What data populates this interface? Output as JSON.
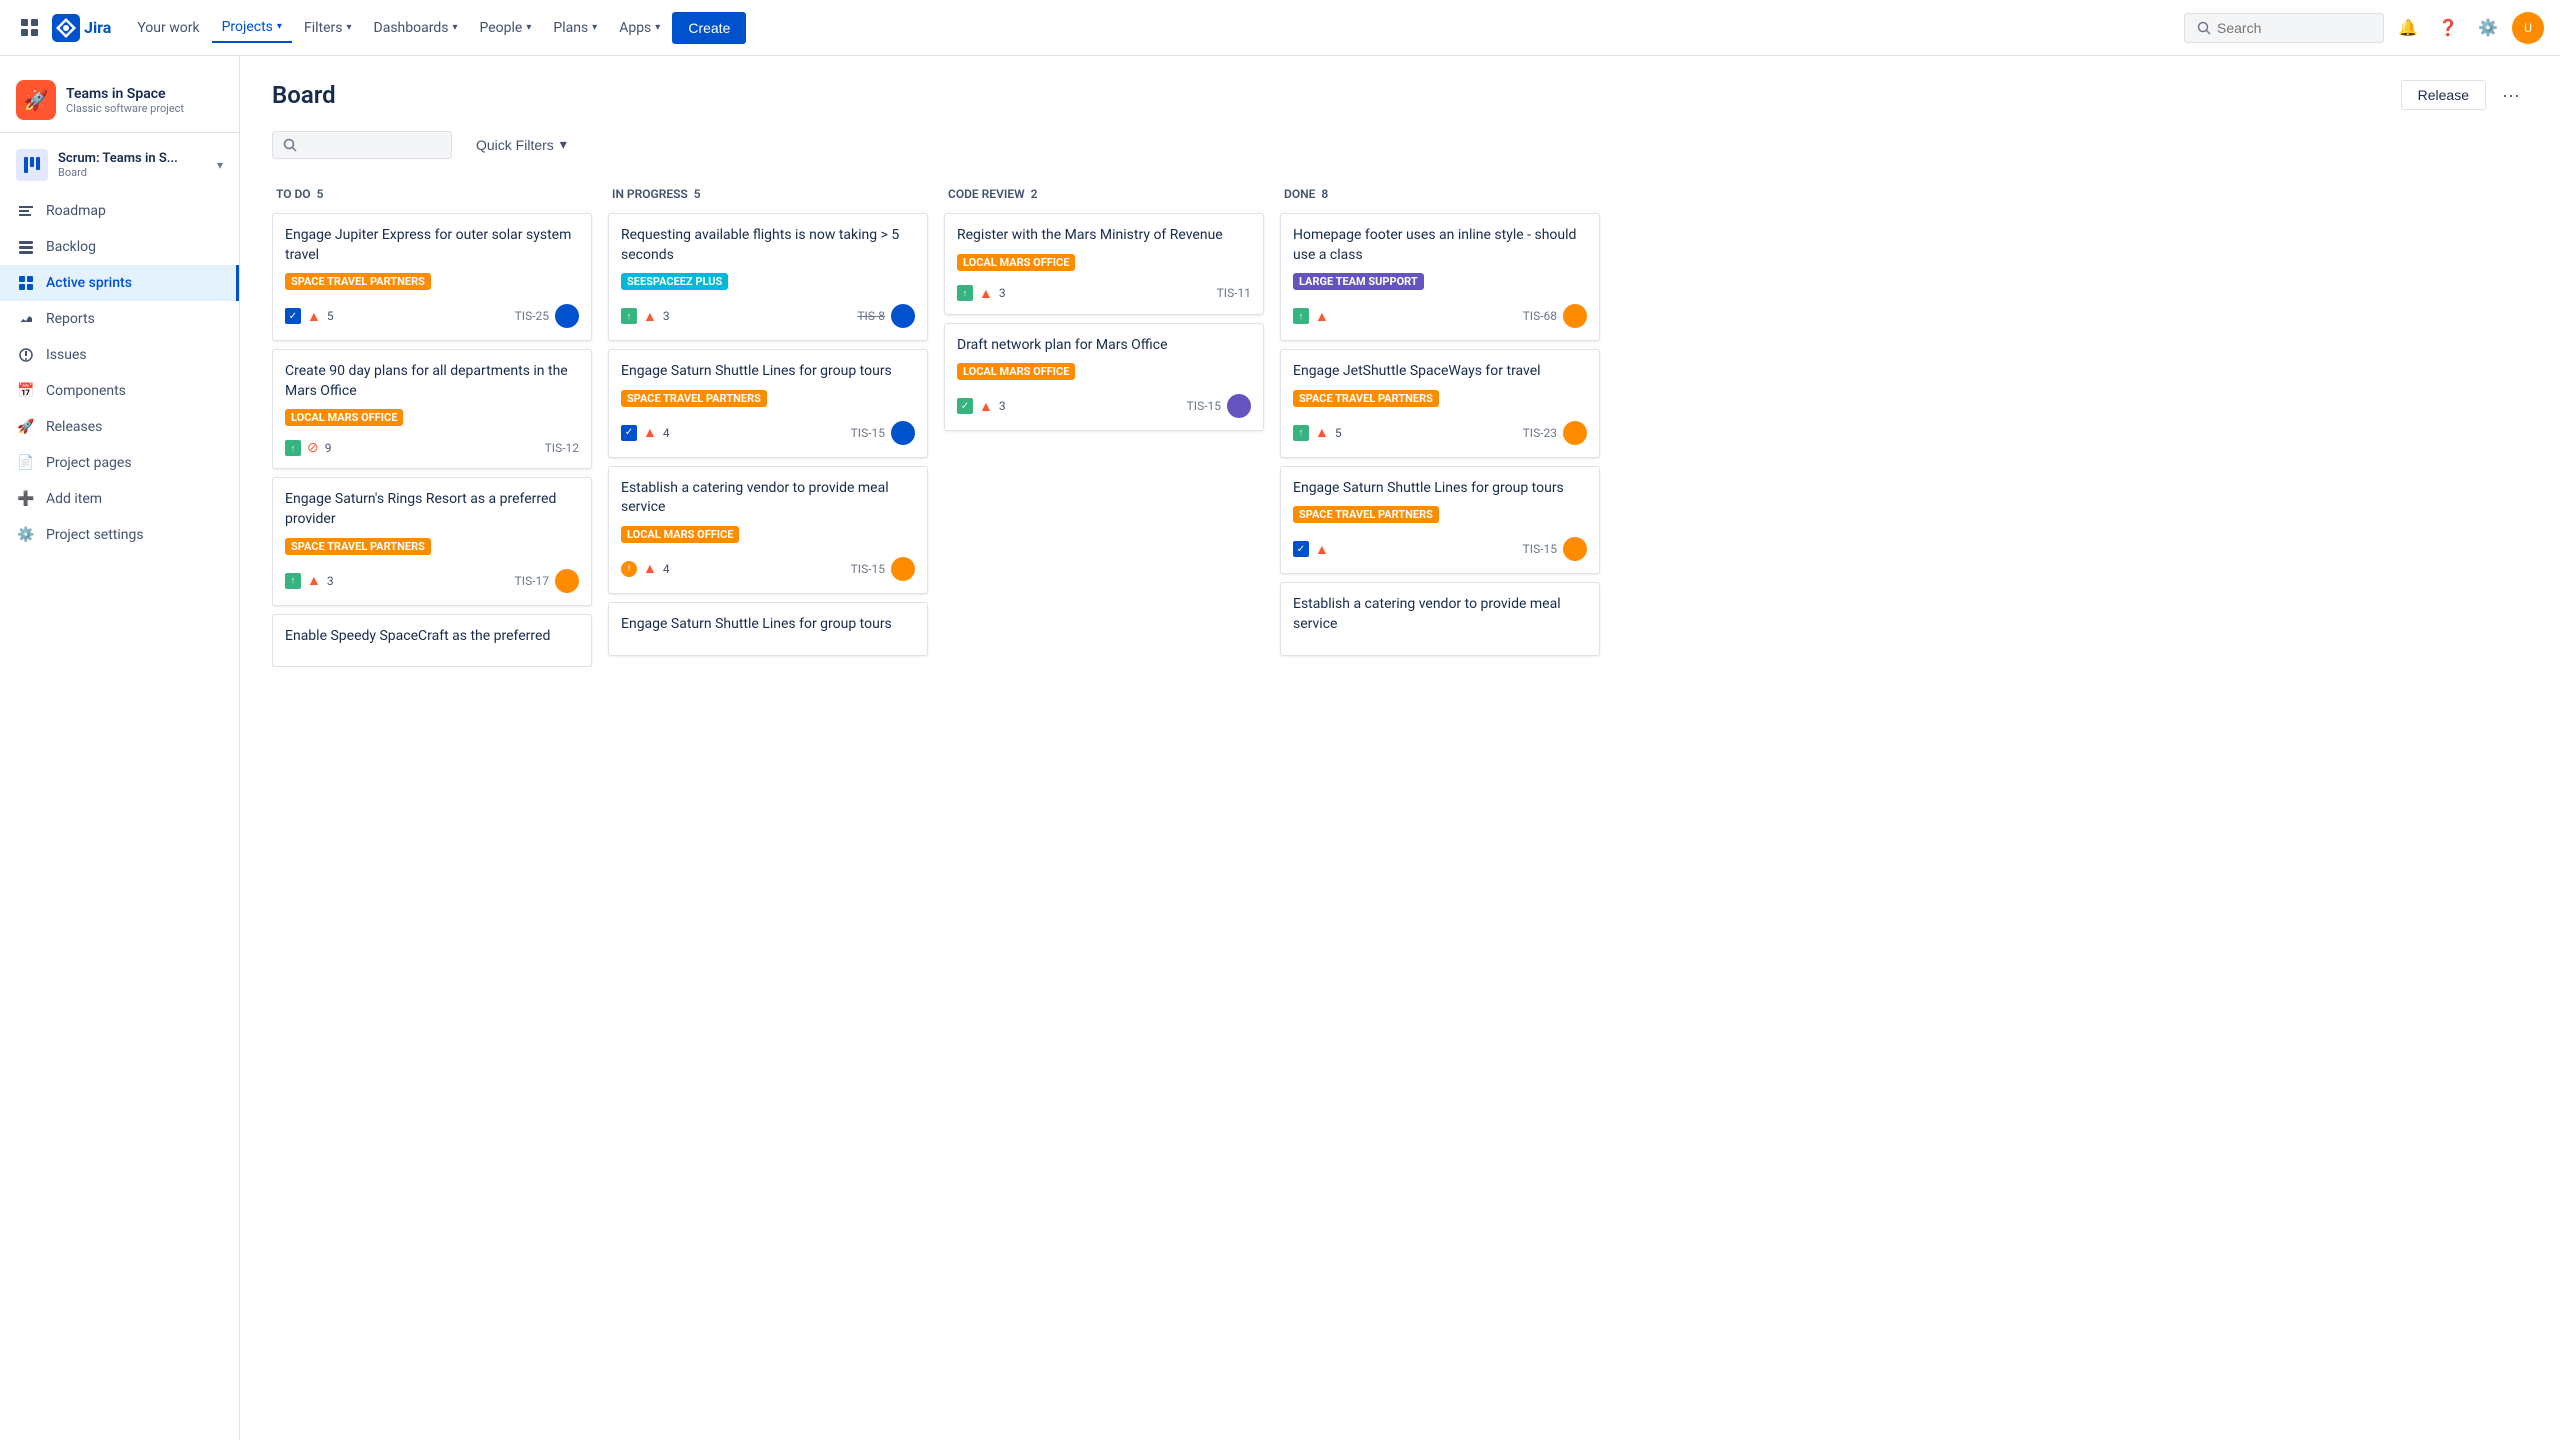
{
  "topnav": {
    "logo_text": "Jira",
    "nav_items": [
      {
        "label": "Your work",
        "active": false
      },
      {
        "label": "Projects",
        "active": true,
        "has_chevron": true
      },
      {
        "label": "Filters",
        "active": false,
        "has_chevron": true
      },
      {
        "label": "Dashboards",
        "active": false,
        "has_chevron": true
      },
      {
        "label": "People",
        "active": false,
        "has_chevron": true
      },
      {
        "label": "Plans",
        "active": false,
        "has_chevron": true
      },
      {
        "label": "Apps",
        "active": false,
        "has_chevron": true
      }
    ],
    "create_label": "Create",
    "search_placeholder": "Search"
  },
  "sidebar": {
    "project_name": "Teams in Space",
    "project_type": "Classic software project",
    "scrum_name": "Scrum: Teams in S...",
    "scrum_sub": "Board",
    "nav_items": [
      {
        "label": "Roadmap",
        "icon": "roadmap"
      },
      {
        "label": "Backlog",
        "icon": "backlog"
      },
      {
        "label": "Active sprints",
        "icon": "sprints",
        "active": true
      },
      {
        "label": "Reports",
        "icon": "reports"
      },
      {
        "label": "Issues",
        "icon": "issues"
      },
      {
        "label": "Components",
        "icon": "components"
      },
      {
        "label": "Releases",
        "icon": "releases"
      },
      {
        "label": "Project pages",
        "icon": "pages"
      },
      {
        "label": "Add item",
        "icon": "add"
      },
      {
        "label": "Project settings",
        "icon": "settings"
      }
    ]
  },
  "board": {
    "title": "Board",
    "release_label": "Release",
    "toolbar": {
      "quick_filters_label": "Quick Filters"
    },
    "columns": [
      {
        "id": "todo",
        "label": "TO DO",
        "count": 5,
        "cards": [
          {
            "title": "Engage Jupiter Express for outer solar system travel",
            "label": "SPACE TRAVEL PARTNERS",
            "label_color": "orange",
            "icons": [
              "check-blue",
              "up-red"
            ],
            "count": 5,
            "id": "TIS-25",
            "avatar_color": "blue"
          },
          {
            "title": "Create 90 day plans for all departments in the Mars Office",
            "label": "LOCAL MARS OFFICE",
            "label_color": "orange",
            "icons": [
              "story-green",
              "block-red"
            ],
            "count": 9,
            "id": "TIS-12",
            "avatar_color": ""
          },
          {
            "title": "Engage Saturn's Rings Resort as a preferred provider",
            "label": "SPACE TRAVEL PARTNERS",
            "label_color": "orange",
            "icons": [
              "story-green",
              "up-red"
            ],
            "count": 3,
            "id": "TIS-17",
            "avatar_color": "orange"
          },
          {
            "title": "Enable Speedy SpaceCraft as the preferred",
            "label": "",
            "label_color": "cyan",
            "icons": [],
            "count": 0,
            "id": "",
            "avatar_color": ""
          }
        ]
      },
      {
        "id": "inprogress",
        "label": "IN PROGRESS",
        "count": 5,
        "cards": [
          {
            "title": "Requesting available flights is now taking > 5 seconds",
            "label": "SEESPACEEZ PLUS",
            "label_color": "cyan",
            "icons": [
              "story-green",
              "up-red"
            ],
            "count": 3,
            "id": "TIS-8",
            "avatar_color": "blue",
            "id_strikethrough": true
          },
          {
            "title": "Engage Saturn Shuttle Lines for group tours",
            "label": "SPACE TRAVEL PARTNERS",
            "label_color": "orange",
            "icons": [
              "check-blue",
              "up-red"
            ],
            "count": 4,
            "id": "TIS-15",
            "avatar_color": "blue"
          },
          {
            "title": "Establish a catering vendor to provide meal service",
            "label": "LOCAL MARS OFFICE",
            "label_color": "orange",
            "icons": [
              "bug-orange",
              "up-red"
            ],
            "count": 4,
            "id": "TIS-15",
            "avatar_color": "orange"
          },
          {
            "title": "Engage Saturn Shuttle Lines for group tours",
            "label": "",
            "label_color": "orange",
            "icons": [],
            "count": 0,
            "id": "",
            "avatar_color": ""
          }
        ]
      },
      {
        "id": "codereview",
        "label": "CODE REVIEW",
        "count": 2,
        "cards": [
          {
            "title": "Register with the Mars Ministry of Revenue",
            "label": "LOCAL MARS OFFICE",
            "label_color": "orange",
            "icons": [
              "story-green",
              "up-red"
            ],
            "count": 3,
            "id": "TIS-11",
            "avatar_color": ""
          },
          {
            "title": "Draft network plan for Mars Office",
            "label": "LOCAL MARS OFFICE",
            "label_color": "orange",
            "icons": [
              "check-green",
              "up-red"
            ],
            "count": 3,
            "id": "TIS-15",
            "avatar_color": "purple"
          }
        ]
      },
      {
        "id": "done",
        "label": "DONE",
        "count": 8,
        "cards": [
          {
            "title": "Homepage footer uses an inline style - should use a class",
            "label": "LARGE TEAM SUPPORT",
            "label_color": "purple",
            "icons": [
              "story-green",
              "up-red"
            ],
            "count": 0,
            "id": "TIS-68",
            "avatar_color": "orange"
          },
          {
            "title": "Engage JetShuttle SpaceWays for travel",
            "label": "SPACE TRAVEL PARTNERS",
            "label_color": "orange",
            "icons": [
              "story-green",
              "up-red"
            ],
            "count": 5,
            "id": "TIS-23",
            "avatar_color": "orange"
          },
          {
            "title": "Engage Saturn Shuttle Lines for group tours",
            "label": "SPACE TRAVEL PARTNERS",
            "label_color": "orange",
            "icons": [
              "check-blue",
              "up-red"
            ],
            "count": 0,
            "id": "TIS-15",
            "avatar_color": "orange"
          },
          {
            "title": "Establish a catering vendor to provide meal service",
            "label": "",
            "label_color": "orange",
            "icons": [],
            "count": 0,
            "id": "",
            "avatar_color": ""
          }
        ]
      }
    ]
  }
}
